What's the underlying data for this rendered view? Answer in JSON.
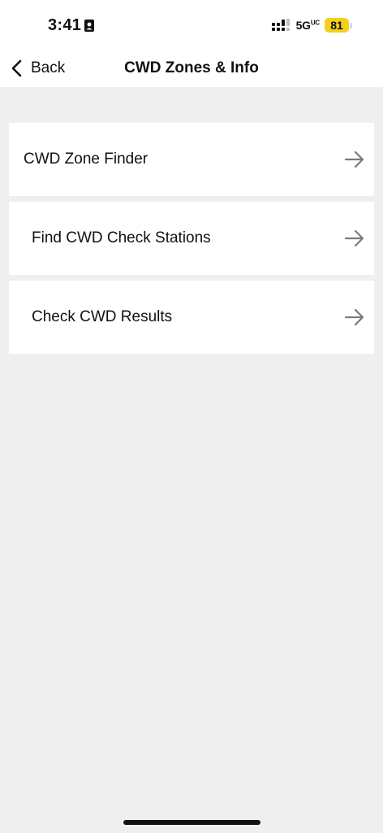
{
  "status_bar": {
    "time": "3:41",
    "network": "5G",
    "network_sub": "UC",
    "battery_level": "81",
    "battery_color": "#f5cf1c"
  },
  "nav": {
    "back_label": "Back",
    "title": "CWD Zones & Info"
  },
  "menu": {
    "items": [
      {
        "label": "CWD Zone Finder",
        "icon": "arrow-right-icon"
      },
      {
        "label": "Find CWD Check Stations",
        "icon": "arrow-right-icon"
      },
      {
        "label": "Check CWD Results",
        "icon": "arrow-right-icon"
      }
    ]
  },
  "colors": {
    "background": "#efefef",
    "card": "#ffffff",
    "arrow": "#7a7a7a"
  }
}
